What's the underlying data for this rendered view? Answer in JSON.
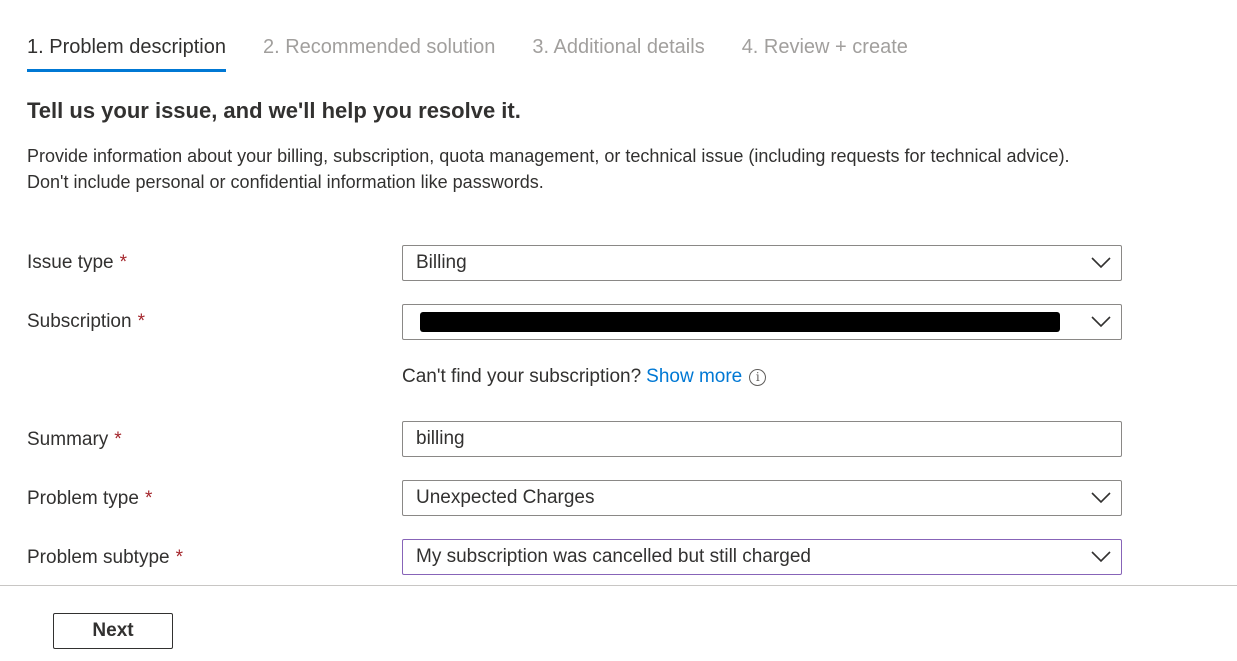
{
  "tabs": [
    {
      "label": "1. Problem description",
      "active": true
    },
    {
      "label": "2. Recommended solution",
      "active": false
    },
    {
      "label": "3. Additional details",
      "active": false
    },
    {
      "label": "4. Review + create",
      "active": false
    }
  ],
  "heading": "Tell us your issue, and we'll help you resolve it.",
  "description": "Provide information about your billing, subscription, quota management, or technical issue (including requests for technical advice). Don't include personal or confidential information like passwords.",
  "required_marker": "*",
  "form": {
    "issue_type": {
      "label": "Issue type",
      "value": "Billing"
    },
    "subscription": {
      "label": "Subscription",
      "value": "(redacted)"
    },
    "subscription_helper": {
      "text": "Can't find your subscription?",
      "link": "Show more",
      "info_icon": "i"
    },
    "summary": {
      "label": "Summary",
      "value": "billing"
    },
    "problem_type": {
      "label": "Problem type",
      "value": "Unexpected Charges"
    },
    "problem_subtype": {
      "label": "Problem subtype",
      "value": "My subscription was cancelled but still charged"
    }
  },
  "footer": {
    "next_label": "Next"
  },
  "colors": {
    "accent": "#0078d4",
    "required": "#a4262c",
    "focus_border": "#8764b8"
  }
}
